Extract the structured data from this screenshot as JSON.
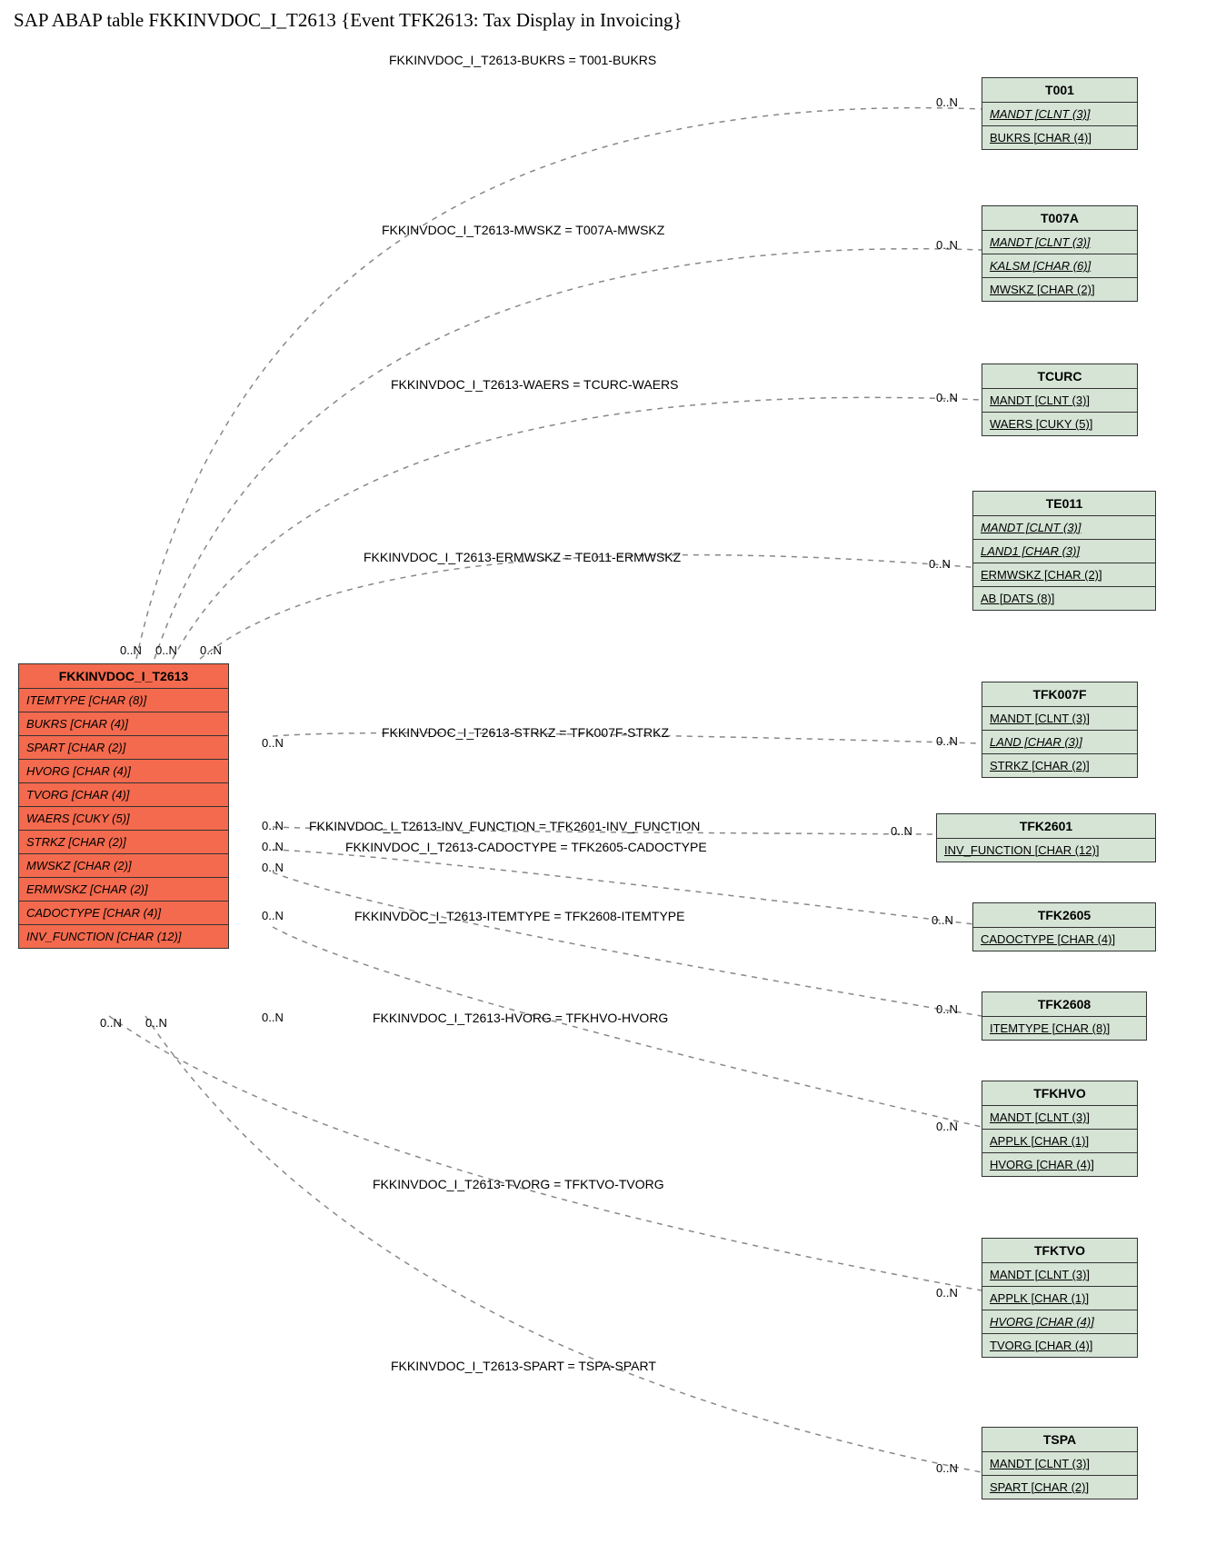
{
  "title": "SAP ABAP table FKKINVDOC_I_T2613 {Event TFK2613: Tax Display in Invoicing}",
  "mainEntity": {
    "name": "FKKINVDOC_I_T2613",
    "fields": [
      {
        "label": "ITEMTYPE [CHAR (8)]",
        "italic": true
      },
      {
        "label": "BUKRS [CHAR (4)]",
        "italic": true
      },
      {
        "label": "SPART [CHAR (2)]",
        "italic": true
      },
      {
        "label": "HVORG [CHAR (4)]",
        "italic": true
      },
      {
        "label": "TVORG [CHAR (4)]",
        "italic": true
      },
      {
        "label": "WAERS [CUKY (5)]",
        "italic": true
      },
      {
        "label": "STRKZ [CHAR (2)]",
        "italic": true
      },
      {
        "label": "MWSKZ [CHAR (2)]",
        "italic": true
      },
      {
        "label": "ERMWSKZ [CHAR (2)]",
        "italic": true
      },
      {
        "label": "CADOCTYPE [CHAR (4)]",
        "italic": true
      },
      {
        "label": "INV_FUNCTION [CHAR (12)]",
        "italic": true
      }
    ]
  },
  "relEntities": [
    {
      "name": "T001",
      "fields": [
        {
          "label": "MANDT [CLNT (3)]",
          "underline": true,
          "italic": true
        },
        {
          "label": "BUKRS [CHAR (4)]",
          "underline": true
        }
      ]
    },
    {
      "name": "T007A",
      "fields": [
        {
          "label": "MANDT [CLNT (3)]",
          "underline": true,
          "italic": true
        },
        {
          "label": "KALSM [CHAR (6)]",
          "underline": true,
          "italic": true
        },
        {
          "label": "MWSKZ [CHAR (2)]",
          "underline": true
        }
      ]
    },
    {
      "name": "TCURC",
      "fields": [
        {
          "label": "MANDT [CLNT (3)]",
          "underline": true
        },
        {
          "label": "WAERS [CUKY (5)]",
          "underline": true
        }
      ]
    },
    {
      "name": "TE011",
      "fields": [
        {
          "label": "MANDT [CLNT (3)]",
          "underline": true,
          "italic": true
        },
        {
          "label": "LAND1 [CHAR (3)]",
          "underline": true,
          "italic": true
        },
        {
          "label": "ERMWSKZ [CHAR (2)]",
          "underline": true
        },
        {
          "label": "AB [DATS (8)]",
          "underline": true
        }
      ]
    },
    {
      "name": "TFK007F",
      "fields": [
        {
          "label": "MANDT [CLNT (3)]",
          "underline": true
        },
        {
          "label": "LAND [CHAR (3)]",
          "underline": true,
          "italic": true
        },
        {
          "label": "STRKZ [CHAR (2)]",
          "underline": true
        }
      ]
    },
    {
      "name": "TFK2601",
      "fields": [
        {
          "label": "INV_FUNCTION [CHAR (12)]",
          "underline": true
        }
      ]
    },
    {
      "name": "TFK2605",
      "fields": [
        {
          "label": "CADOCTYPE [CHAR (4)]",
          "underline": true
        }
      ]
    },
    {
      "name": "TFK2608",
      "fields": [
        {
          "label": "ITEMTYPE [CHAR (8)]",
          "underline": true
        }
      ]
    },
    {
      "name": "TFKHVO",
      "fields": [
        {
          "label": "MANDT [CLNT (3)]",
          "underline": true
        },
        {
          "label": "APPLK [CHAR (1)]",
          "underline": true
        },
        {
          "label": "HVORG [CHAR (4)]",
          "underline": true
        }
      ]
    },
    {
      "name": "TFKTVO",
      "fields": [
        {
          "label": "MANDT [CLNT (3)]",
          "underline": true
        },
        {
          "label": "APPLK [CHAR (1)]",
          "underline": true
        },
        {
          "label": "HVORG [CHAR (4)]",
          "underline": true,
          "italic": true
        },
        {
          "label": "TVORG [CHAR (4)]",
          "underline": true
        }
      ]
    },
    {
      "name": "TSPA",
      "fields": [
        {
          "label": "MANDT [CLNT (3)]",
          "underline": true
        },
        {
          "label": "SPART [CHAR (2)]",
          "underline": true
        }
      ]
    }
  ],
  "relations": {
    "r0": "FKKINVDOC_I_T2613-BUKRS = T001-BUKRS",
    "r1": "FKKINVDOC_I_T2613-MWSKZ = T007A-MWSKZ",
    "r2": "FKKINVDOC_I_T2613-WAERS = TCURC-WAERS",
    "r3": "FKKINVDOC_I_T2613-ERMWSKZ = TE011-ERMWSKZ",
    "r4": "FKKINVDOC_I_T2613-STRKZ = TFK007F-STRKZ",
    "r5": "FKKINVDOC_I_T2613-INV_FUNCTION = TFK2601-INV_FUNCTION",
    "r6": "FKKINVDOC_I_T2613-CADOCTYPE = TFK2605-CADOCTYPE",
    "r7": "FKKINVDOC_I_T2613-ITEMTYPE = TFK2608-ITEMTYPE",
    "r8": "FKKINVDOC_I_T2613-HVORG = TFKHVO-HVORG",
    "r9": "FKKINVDOC_I_T2613-TVORG = TFKTVO-TVORG",
    "r10": "FKKINVDOC_I_T2613-SPART = TSPA-SPART"
  },
  "card": "0..N"
}
